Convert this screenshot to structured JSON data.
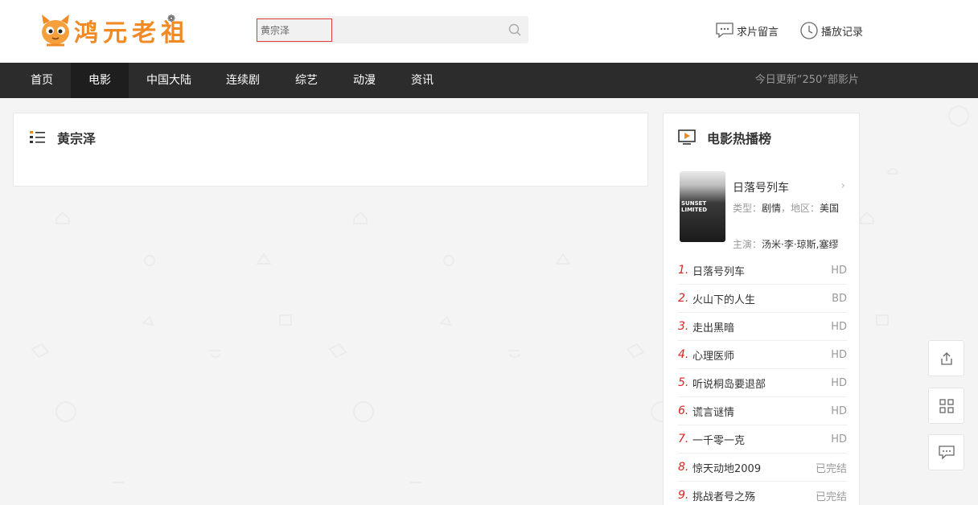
{
  "header": {
    "logo_text": "鸿元老祖",
    "search_value": "黄宗泽",
    "links": [
      {
        "label": "求片留言",
        "icon": "message-icon"
      },
      {
        "label": "播放记录",
        "icon": "clock-icon"
      }
    ]
  },
  "nav": {
    "items": [
      {
        "label": "首页"
      },
      {
        "label": "电影"
      },
      {
        "label": "中国大陆"
      },
      {
        "label": "连续剧"
      },
      {
        "label": "综艺"
      },
      {
        "label": "动漫"
      },
      {
        "label": "资讯"
      }
    ],
    "active_index": 1,
    "update_text": "今日更新“250”部影片"
  },
  "main": {
    "title": "黄宗泽"
  },
  "sidebar": {
    "title": "电影热播榜",
    "featured": {
      "name": "日落号列车",
      "type_label": "类型：",
      "type_value": "剧情",
      "region_label": "，地区：",
      "region_value": "美国",
      "cast_label": "主演：",
      "cast_value": "汤米·李·琼斯,塞缪",
      "poster_text": "SUNSET LIMITED"
    },
    "ranks": [
      {
        "num": "1.",
        "name": "日落号列车",
        "status": "HD"
      },
      {
        "num": "2.",
        "name": "火山下的人生",
        "status": "BD"
      },
      {
        "num": "3.",
        "name": "走出黑暗",
        "status": "HD"
      },
      {
        "num": "4.",
        "name": "心理医师",
        "status": "HD"
      },
      {
        "num": "5.",
        "name": "听说桐岛要退部",
        "status": "HD"
      },
      {
        "num": "6.",
        "name": "谎言谜情",
        "status": "HD"
      },
      {
        "num": "7.",
        "name": "一千零一克",
        "status": "HD"
      },
      {
        "num": "8.",
        "name": "惊天动地2009",
        "status": "已完结"
      },
      {
        "num": "9.",
        "name": "挑战者号之殇",
        "status": "已完结"
      }
    ]
  },
  "float_buttons": [
    {
      "icon": "share-icon"
    },
    {
      "icon": "qrcode-icon"
    },
    {
      "icon": "feedback-icon"
    }
  ],
  "colors": {
    "accent": "#f08a24",
    "nav_bg": "#2c2c2c",
    "rank_num": "#e02020"
  }
}
